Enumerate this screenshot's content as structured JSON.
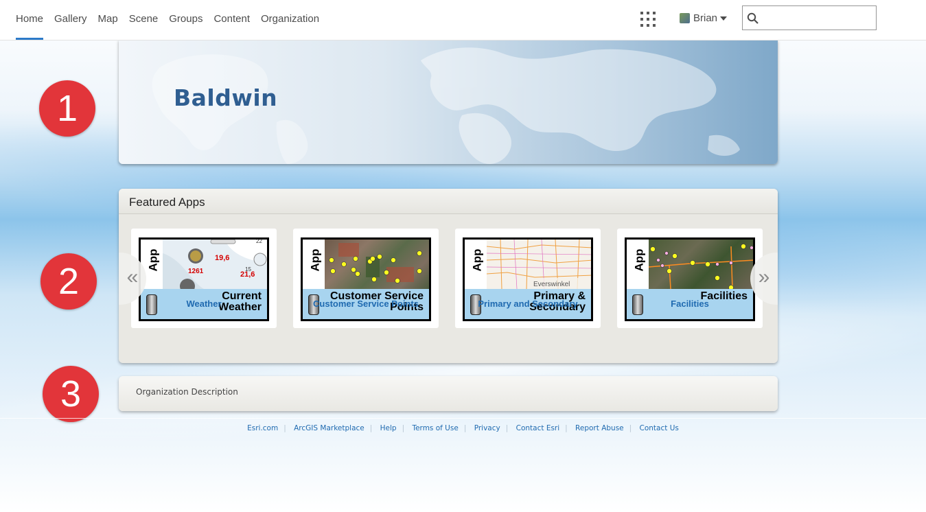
{
  "nav": {
    "links": [
      "Home",
      "Gallery",
      "Map",
      "Scene",
      "Groups",
      "Content",
      "Organization"
    ],
    "active": "Home",
    "user_name": "Brian",
    "search_placeholder": ""
  },
  "banner": {
    "title": "Baldwin"
  },
  "badges": [
    "1",
    "2",
    "3"
  ],
  "featured": {
    "title": "Featured Apps",
    "prev_arrow": "«",
    "next_arrow": "»",
    "apps": [
      {
        "thumb_tag": "App",
        "thumb_title_1": "Current",
        "thumb_title_2": "Weather",
        "caption": "Weather"
      },
      {
        "thumb_tag": "App",
        "thumb_title_1": "Customer Service",
        "thumb_title_2": "Points",
        "caption": "Customer Service Points"
      },
      {
        "thumb_tag": "App",
        "thumb_title_1": "Primary &",
        "thumb_title_2": "Secondary",
        "caption": "Primary and Secondary"
      },
      {
        "thumb_tag": "App",
        "thumb_title_1": "Facilities",
        "thumb_title_2": "",
        "caption": "Facilities"
      }
    ],
    "weather_labels": [
      "19,6",
      "21,6",
      "1261",
      "15",
      "22"
    ],
    "map_label": "Everswinkel"
  },
  "description": {
    "text": "Organization Description"
  },
  "footer": {
    "links": [
      "Esri.com",
      "ArcGIS Marketplace",
      "Help",
      "Terms of Use",
      "Privacy",
      "Contact Esri",
      "Report Abuse",
      "Contact Us"
    ]
  },
  "colors": {
    "accent": "#2c7ac9",
    "link": "#1f6ab0",
    "badge": "#e2353a",
    "title": "#2f5e91"
  }
}
